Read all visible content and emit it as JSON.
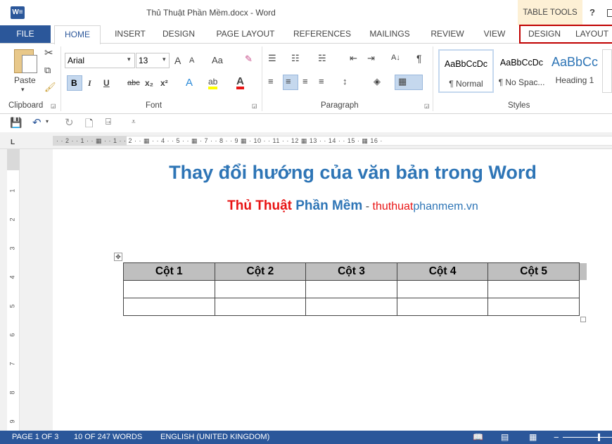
{
  "app": {
    "logo": "W≡",
    "title": "Thủ Thuật Phần Mềm.docx - Word",
    "table_tools": "TABLE TOOLS",
    "help": "?"
  },
  "tabs": [
    {
      "label": "FILE"
    },
    {
      "label": "HOME"
    },
    {
      "label": "INSERT"
    },
    {
      "label": "DESIGN"
    },
    {
      "label": "PAGE LAYOUT"
    },
    {
      "label": "REFERENCES"
    },
    {
      "label": "MAILINGS"
    },
    {
      "label": "REVIEW"
    },
    {
      "label": "VIEW"
    },
    {
      "label": "DESIGN"
    },
    {
      "label": "LAYOUT"
    }
  ],
  "ribbon": {
    "clipboard": {
      "paste": "Paste",
      "label": "Clipboard"
    },
    "font": {
      "name": "Arial",
      "size": "13",
      "grow": "A",
      "shrink": "A",
      "case": "Aa",
      "bold": "B",
      "italic": "I",
      "underline": "U",
      "strike": "abc",
      "sub": "x₂",
      "sup": "x²",
      "effects": "A",
      "highlight": "ab",
      "color": "A",
      "label": "Font"
    },
    "paragraph": {
      "label": "Paragraph",
      "sort": "A↓",
      "pilcrow": "¶"
    },
    "styles": {
      "label": "Styles",
      "items": [
        {
          "sample": "AaBbCcDc",
          "name": "¶ Normal"
        },
        {
          "sample": "AaBbCcDc",
          "name": "¶ No Spac..."
        },
        {
          "sample": "AaBbCc",
          "name": "Heading 1"
        }
      ]
    }
  },
  "ruler": {
    "h_ticks": "·  ·  2 ·  ·  1 ·  ·  ▦  ·  ·  1 ·  ·  2 ·  ·  ▦  ·  ·  4 ·  ·  5 ·  ·  ▦  ·  7 ·  ·  8 ·  ·  9 ▦  ·  10 ·  ·  11 ·  ·  12 ▦ 13 ·  ·  14 ·  ·  15 ·  ▦ 16 ·",
    "v_ticks": [
      "1",
      "2",
      "3",
      "4",
      "5",
      "6",
      "7",
      "8",
      "9"
    ],
    "corner": "L"
  },
  "document": {
    "heading": "Thay đổi hướng của văn bản trong Word",
    "sub_a": "Thủ Thuật",
    "sub_b": "Phần Mềm",
    "sub_dash": " - ",
    "sub_c": "thuthuat",
    "sub_d": "phanmem.vn",
    "table": {
      "headers": [
        "Cột 1",
        "Cột 2",
        "Cột 3",
        "Cột 4",
        "Cột 5"
      ],
      "rows": [
        [
          "",
          "",
          "",
          "",
          ""
        ],
        [
          "",
          "",
          "",
          "",
          ""
        ]
      ]
    }
  },
  "status": {
    "page": "PAGE 1 OF 3",
    "words": "10 OF 247 WORDS",
    "lang": "ENGLISH (UNITED KINGDOM)"
  },
  "colors": {
    "brand": "#2b579a",
    "heading": "#2e75b6",
    "accent_red": "#e81414",
    "highlight_box": "#c00000"
  }
}
